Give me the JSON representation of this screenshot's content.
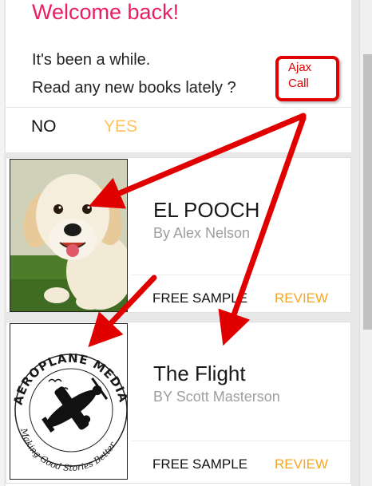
{
  "welcome": {
    "title": "Welcome back!",
    "line1": "It's been a while.",
    "line2": "Read any new books lately ?",
    "no_label": "NO",
    "yes_label": "YES"
  },
  "books": [
    {
      "title": "EL POOCH",
      "author": "By Alex Nelson",
      "free_sample_label": "FREE SAMPLE",
      "review_label": "REVIEW",
      "cover_icon": "golden-retriever-puppy-photo"
    },
    {
      "title": "The Flight",
      "author": "BY Scott Masterson",
      "free_sample_label": "FREE SAMPLE",
      "review_label": "REVIEW",
      "cover_icon": "aeroplane-media-logo"
    }
  ],
  "logo_text": {
    "top": "AEROPLANE MEDIA",
    "bottom": "Making Good Stories Better"
  },
  "annotation": {
    "line1": "Ajax",
    "line2": "Call"
  },
  "colors": {
    "accent_pink": "#e91e63",
    "yes_orange": "#ffc15e",
    "review_orange": "#f5a623",
    "annotation_red": "#e00000"
  }
}
